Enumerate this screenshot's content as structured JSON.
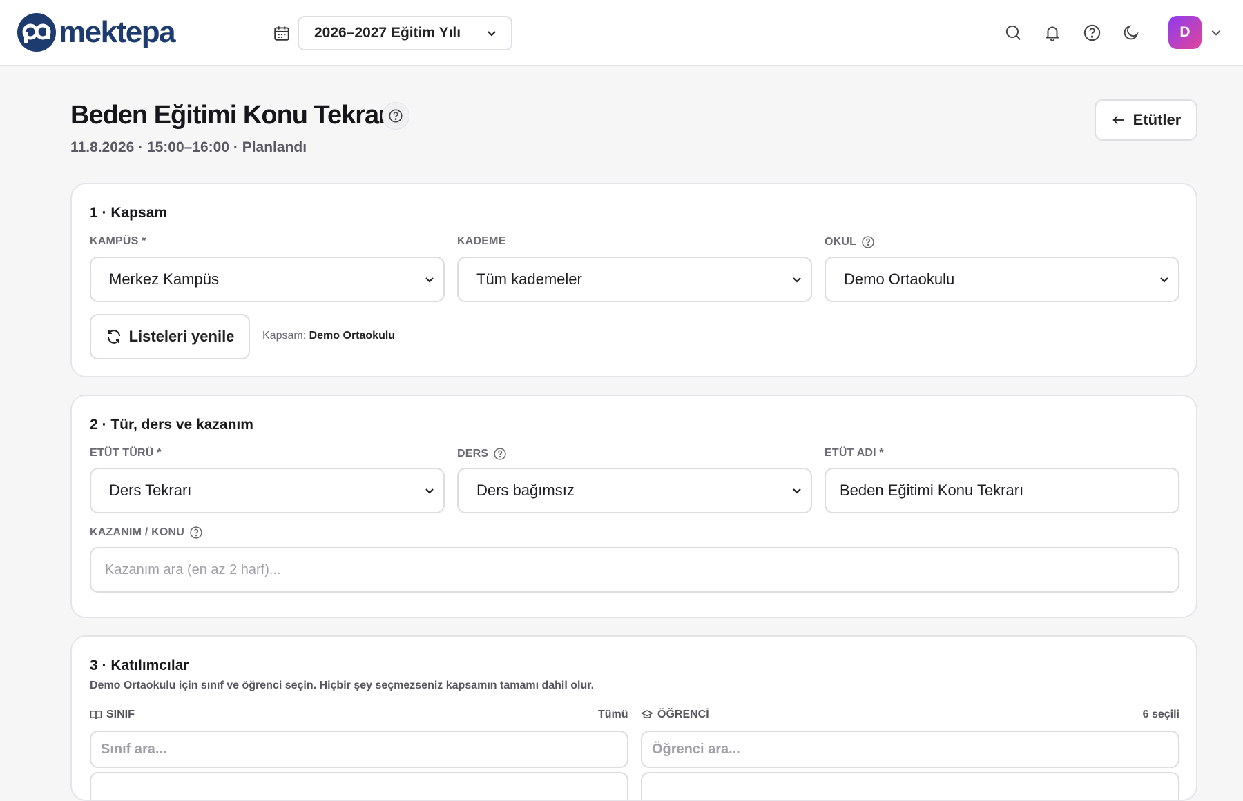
{
  "header": {
    "logo_text": "mektepa",
    "logo_mark": "pa",
    "academic_year": "2026–2027 Eğitim Yılı",
    "avatar_initial": "D",
    "icons": [
      "search-icon",
      "bell-icon",
      "help-icon",
      "moon-icon"
    ]
  },
  "page": {
    "title": "Beden Eğitimi Konu Tekrarı",
    "subtitle": "11.8.2026 · 15:00–16:00 · Planlandı",
    "back_label": "Etütler"
  },
  "scope": {
    "title": "1 · Kapsam",
    "campus_label": "KAMPÜS *",
    "campus_value": "Merkez Kampüs",
    "level_label": "KADEME",
    "level_value": "Tüm kademeler",
    "school_label": "OKUL",
    "school_value": "Demo Ortaokulu",
    "refresh_label": "Listeleri yenile",
    "scope_prefix": "Kapsam:",
    "scope_value": "Demo Ortaokulu"
  },
  "type": {
    "title": "2 · Tür, ders ve kazanım",
    "etut_type_label": "ETÜT TÜRÜ *",
    "etut_type_value": "Ders Tekrarı",
    "lesson_label": "DERS",
    "lesson_value": "Ders bağımsız",
    "name_label": "ETÜT ADI *",
    "name_value": "Beden Eğitimi Konu Tekrarı",
    "outcome_label": "KAZANIM / KONU",
    "outcome_placeholder": "Kazanım ara (en az 2 harf)..."
  },
  "participants": {
    "title": "3 · Katılımcılar",
    "description": "Demo Ortaokulu için sınıf ve öğrenci seçin. Hiçbir şey seçmezseniz kapsamın tamamı dahil olur.",
    "class_label": "SINIF",
    "class_meta": "Tümü",
    "class_placeholder": "Sınıf ara...",
    "student_label": "ÖĞRENCİ",
    "student_meta": "6 seçili",
    "student_placeholder": "Öğrenci ara..."
  },
  "colors": {
    "brand": "#1e3b6f",
    "avatar_gradient_start": "#8e3cf0",
    "avatar_gradient_end": "#e0459b"
  }
}
